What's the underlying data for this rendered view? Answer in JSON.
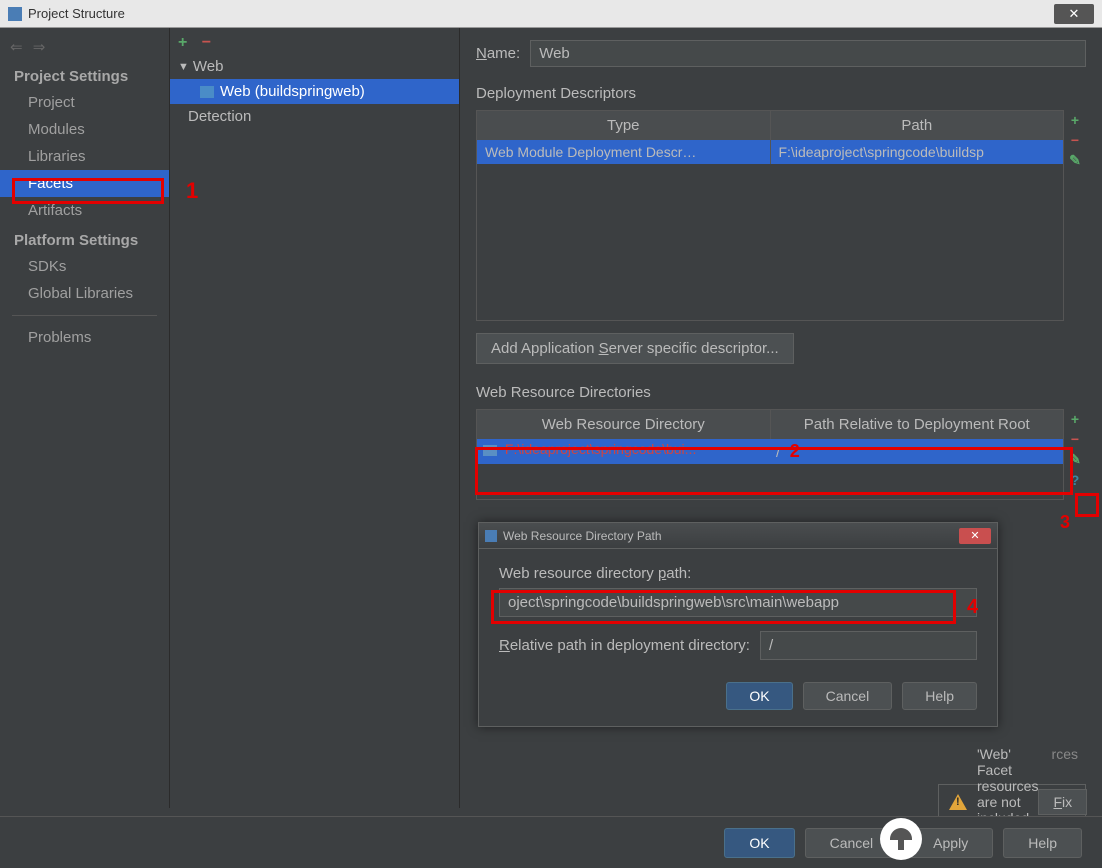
{
  "window": {
    "title": "Project Structure"
  },
  "sidebar": {
    "sections": [
      {
        "header": "Project Settings",
        "items": [
          "Project",
          "Modules",
          "Libraries",
          "Facets",
          "Artifacts"
        ]
      },
      {
        "header": "Platform Settings",
        "items": [
          "SDKs",
          "Global Libraries"
        ]
      }
    ],
    "problems": "Problems",
    "selected": "Facets"
  },
  "tree": {
    "root": "Web",
    "child": "Web (buildspringweb)",
    "detection": "Detection"
  },
  "content": {
    "name_label": "Name:",
    "name_value": "Web",
    "deploy_label": "Deployment Descriptors",
    "deploy_cols": [
      "Type",
      "Path"
    ],
    "deploy_row": {
      "type": "Web Module Deployment Descr…",
      "path": "F:\\ideaproject\\springcode\\buildsp"
    },
    "add_server_btn": "Add Application Server specific descriptor...",
    "webres_label": "Web Resource Directories",
    "webres_cols": [
      "Web Resource Directory",
      "Path Relative to Deployment Root"
    ],
    "webres_row": {
      "dir": "F:\\ideaproject\\springcode\\bui...",
      "rel": "/"
    },
    "sources_label": "rces",
    "warning": "'Web' Facet resources are not included in an artifact",
    "fix_btn": "Fix"
  },
  "inner_dialog": {
    "title": "Web Resource Directory Path",
    "path_label": "Web resource directory path:",
    "path_value": "oject\\springcode\\buildspringweb\\src\\main\\webapp",
    "rel_label": "Relative path in deployment directory:",
    "rel_value": "/",
    "ok": "OK",
    "cancel": "Cancel",
    "help": "Help"
  },
  "bottom": {
    "ok": "OK",
    "cancel": "Cancel",
    "apply": "Apply",
    "help": "Help"
  },
  "annotations": {
    "a1": "1",
    "a2": "2",
    "a3": "3",
    "a4": "4"
  }
}
